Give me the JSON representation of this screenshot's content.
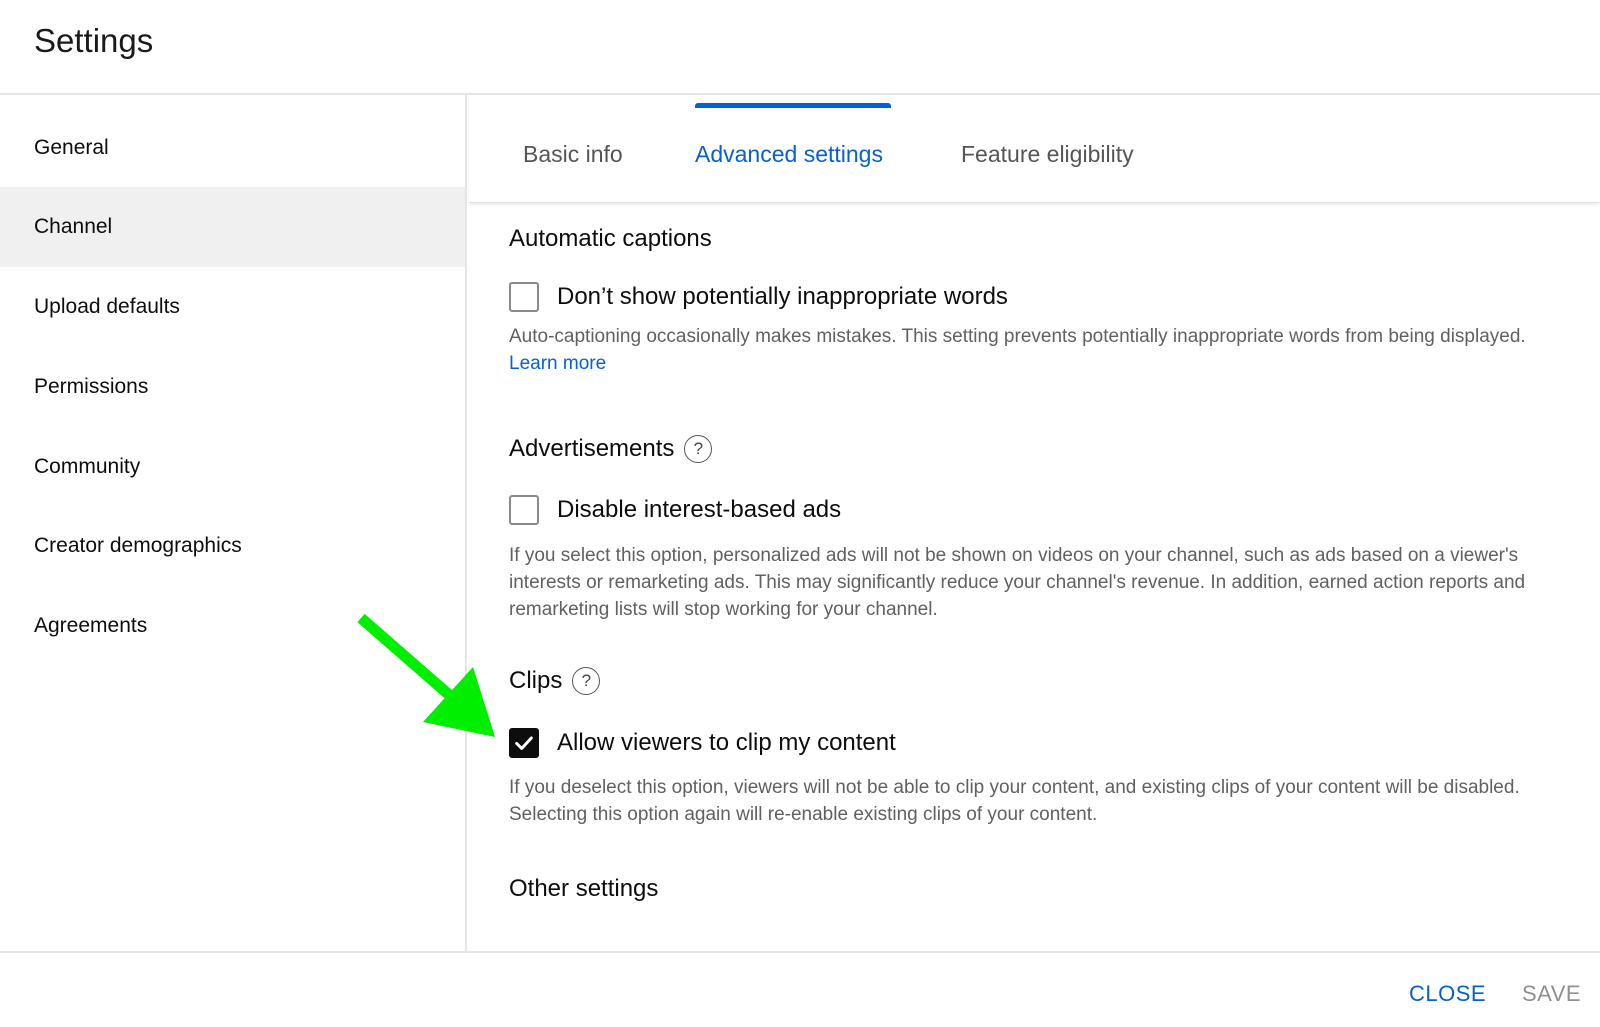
{
  "header": {
    "title": "Settings"
  },
  "sidebar": {
    "items": [
      {
        "label": "General",
        "active": false
      },
      {
        "label": "Channel",
        "active": true
      },
      {
        "label": "Upload defaults",
        "active": false
      },
      {
        "label": "Permissions",
        "active": false
      },
      {
        "label": "Community",
        "active": false
      },
      {
        "label": "Creator demographics",
        "active": false
      },
      {
        "label": "Agreements",
        "active": false
      }
    ]
  },
  "tabs": [
    {
      "label": "Basic info",
      "active": false
    },
    {
      "label": "Advanced settings",
      "active": true
    },
    {
      "label": "Feature eligibility",
      "active": false
    }
  ],
  "sections": {
    "captions": {
      "title": "Automatic captions",
      "checkbox_label": "Don’t show potentially inappropriate words",
      "checked": false,
      "description": "Auto-captioning occasionally makes mistakes. This setting prevents potentially inappropriate words from being displayed.",
      "link": "Learn more"
    },
    "ads": {
      "title": "Advertisements",
      "help_icon": "help-circle-icon",
      "checkbox_label": "Disable interest-based ads",
      "checked": false,
      "description": "If you select this option, personalized ads will not be shown on videos on your channel, such as ads based on a viewer's interests or remarketing ads. This may significantly reduce your channel's revenue. In addition, earned action reports and remarketing lists will stop working for your channel."
    },
    "clips": {
      "title": "Clips",
      "help_icon": "help-circle-icon",
      "checkbox_label": "Allow viewers to clip my content",
      "checked": true,
      "description": "If you deselect this option, viewers will not be able to clip your content, and existing clips of your content will be disabled. Selecting this option again will re-enable existing clips of your content."
    },
    "other": {
      "title": "Other settings"
    }
  },
  "footer": {
    "close_label": "CLOSE",
    "save_label": "SAVE"
  },
  "annotation": {
    "icon": "green-arrow-icon",
    "color": "#00ff00"
  },
  "colors": {
    "accent": "#065fd4",
    "text_secondary": "#606060",
    "active_nav_bg": "#f0f0f0"
  }
}
